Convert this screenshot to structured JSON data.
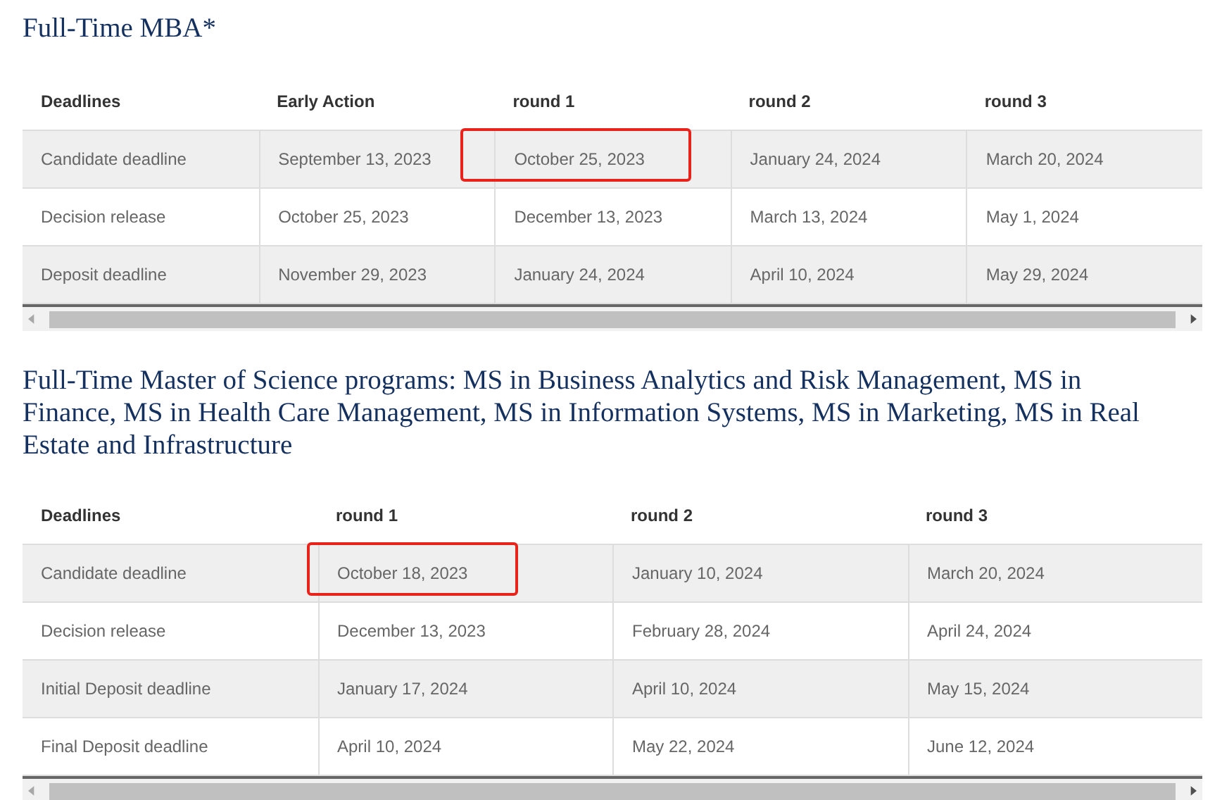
{
  "sections": [
    {
      "title": "Full-Time MBA*",
      "columns": [
        "Deadlines",
        "Early Action",
        "round 1",
        "round 2",
        "round 3"
      ],
      "rows": [
        {
          "cells": [
            {
              "text": "Candidate deadline",
              "highlighted": false
            },
            {
              "text": "September 13, 2023",
              "highlighted": false
            },
            {
              "text": "October 25, 2023",
              "highlighted": true
            },
            {
              "text": "January 24, 2024",
              "highlighted": false
            },
            {
              "text": "March 20, 2024",
              "highlighted": false
            }
          ]
        },
        {
          "cells": [
            {
              "text": "Decision release",
              "highlighted": false
            },
            {
              "text": "October 25, 2023",
              "highlighted": false
            },
            {
              "text": "December 13, 2023",
              "highlighted": false
            },
            {
              "text": "March 13, 2024",
              "highlighted": false
            },
            {
              "text": "May 1, 2024",
              "highlighted": false
            }
          ]
        },
        {
          "cells": [
            {
              "text": "Deposit deadline",
              "highlighted": false
            },
            {
              "text": "November 29, 2023",
              "highlighted": false
            },
            {
              "text": "January 24, 2024",
              "highlighted": false
            },
            {
              "text": "April 10, 2024",
              "highlighted": false
            },
            {
              "text": "May 29, 2024",
              "highlighted": false
            }
          ]
        }
      ]
    },
    {
      "title": "Full-Time Master of Science programs: MS in Business Analytics and Risk Management, MS in Finance, MS in Health Care Management, MS in Information Systems, MS in Marketing, MS in Real Estate and Infrastructure",
      "columns": [
        "Deadlines",
        "round 1",
        "round 2",
        "round 3"
      ],
      "rows": [
        {
          "cells": [
            {
              "text": "Candidate deadline",
              "highlighted": false
            },
            {
              "text": "October 18, 2023",
              "highlighted": true
            },
            {
              "text": "January 10, 2024",
              "highlighted": false
            },
            {
              "text": "March 20, 2024",
              "highlighted": false
            }
          ]
        },
        {
          "cells": [
            {
              "text": "Decision release",
              "highlighted": false
            },
            {
              "text": "December 13, 2023",
              "highlighted": false
            },
            {
              "text": "February 28, 2024",
              "highlighted": false
            },
            {
              "text": "April 24, 2024",
              "highlighted": false
            }
          ]
        },
        {
          "cells": [
            {
              "text": "Initial Deposit deadline",
              "highlighted": false
            },
            {
              "text": "January 17, 2024",
              "highlighted": false
            },
            {
              "text": "April 10, 2024",
              "highlighted": false
            },
            {
              "text": "May 15, 2024",
              "highlighted": false
            }
          ]
        },
        {
          "cells": [
            {
              "text": "Final Deposit deadline",
              "highlighted": false
            },
            {
              "text": "April 10, 2024",
              "highlighted": false
            },
            {
              "text": "May 22, 2024",
              "highlighted": false
            },
            {
              "text": "June 12, 2024",
              "highlighted": false
            }
          ]
        }
      ]
    }
  ]
}
